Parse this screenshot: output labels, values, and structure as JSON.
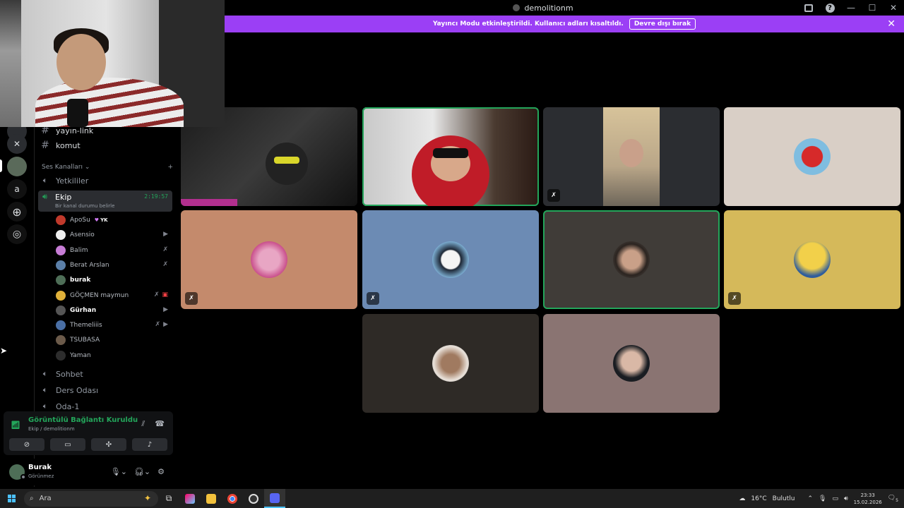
{
  "window": {
    "title": "demolitionm"
  },
  "banner": {
    "text": "Yayıncı Modu etkinleştirildi. Kullanıcı adları kısaltıldı.",
    "button": "Devre dışı bırak"
  },
  "rail": {
    "badge": "",
    "letter": "a"
  },
  "channels": {
    "text": [
      "yayın-link",
      "komut"
    ],
    "voice_category": "Ses Kanalları",
    "voice_before": "Yetkililer",
    "active": {
      "name": "Ekip",
      "status": "Bir kanal durumu belirle",
      "timer": "2:19:57"
    },
    "members": [
      {
        "name": "ApoSu",
        "role": "YK",
        "color": "#c0392b"
      },
      {
        "name": "Asensio",
        "color": "#eeeeee"
      },
      {
        "name": "Balim",
        "color": "#c77dd6"
      },
      {
        "name": "Berat Arslan",
        "color": "#5b7fa8"
      },
      {
        "name": "burak",
        "color": "#4e6e57"
      },
      {
        "name": "GÖÇMEN maymun",
        "color": "#e0b13a"
      },
      {
        "name": "Gürhan",
        "color": "#555555"
      },
      {
        "name": "Themeliiis",
        "color": "#4a6fa5"
      },
      {
        "name": "TSUBASA",
        "color": "#6b5a4a"
      },
      {
        "name": "Yaman",
        "color": "#2d2d2d"
      }
    ],
    "voice_after": [
      "Sohbet",
      "Ders Odası",
      "Oda-1"
    ]
  },
  "connection": {
    "title": "Görüntülü Bağlantı Kuruldu",
    "subtitle": "Ekip / demolitionm"
  },
  "user": {
    "name": "Burak",
    "status": "Görünmez"
  },
  "taskbar": {
    "search_placeholder": "Ara",
    "weather_temp": "16°C",
    "weather_text": "Bulutlu",
    "time": "23:33",
    "date": "15.02.2026",
    "notifications": "5"
  },
  "colors": {
    "accent": "#9b3ff5",
    "speaking": "#23a55a"
  }
}
